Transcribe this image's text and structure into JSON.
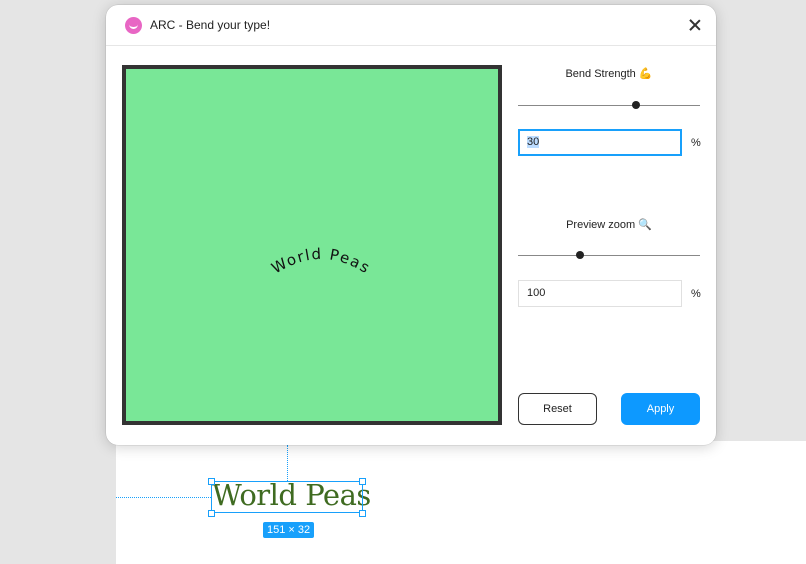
{
  "window": {
    "title": "ARC - Bend your type!"
  },
  "preview": {
    "background": "#79e797",
    "text": "World Peas"
  },
  "bend": {
    "label": "Bend Strength 💪",
    "value": "30",
    "unit": "%",
    "slider_fraction": 0.65
  },
  "zoom": {
    "label": "Preview zoom 🔍",
    "value": "100",
    "unit": "%",
    "slider_fraction": 0.34
  },
  "buttons": {
    "reset": "Reset",
    "apply": "Apply"
  },
  "canvas": {
    "text": "World Peas",
    "size_badge": "151 × 32",
    "text_color": "#3f6b21"
  },
  "colors": {
    "accent": "#18a0fb",
    "apply": "#0d99ff",
    "icon": "#e866c4"
  }
}
